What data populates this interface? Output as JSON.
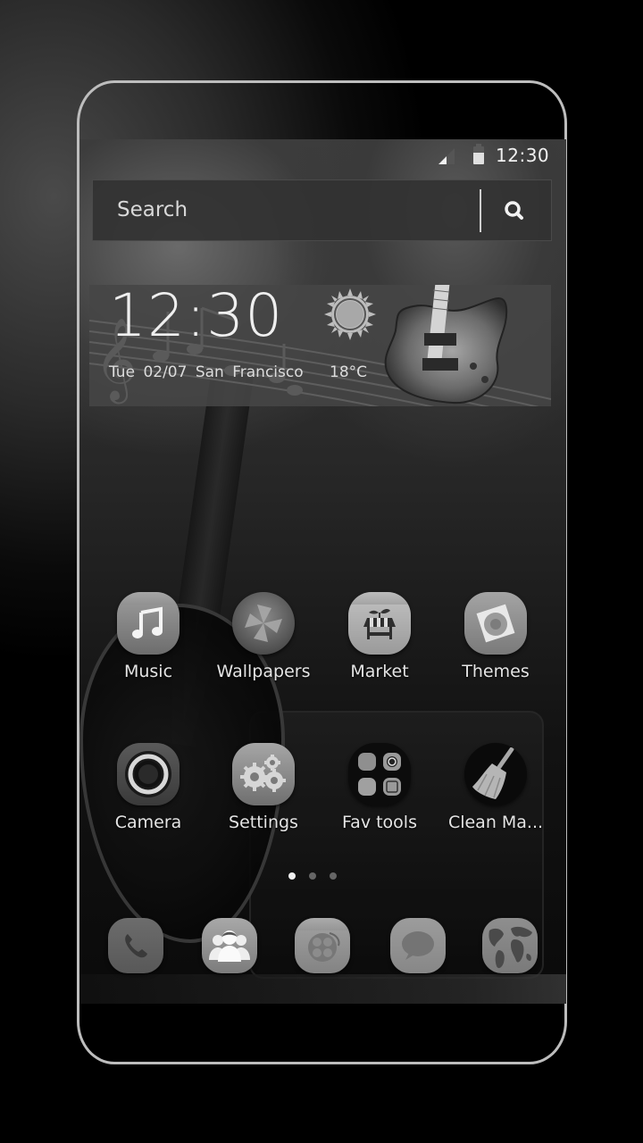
{
  "status_bar": {
    "time": "12:30",
    "icons": [
      "signal-icon",
      "battery-icon"
    ]
  },
  "search": {
    "placeholder": "Search",
    "button_icon": "search-icon"
  },
  "widget": {
    "time": "12:30",
    "day": "Tue",
    "date": "02/07",
    "city": "San Francisco",
    "date_line": "Tue  02/07  San Francisco",
    "temperature": "18°C",
    "weather_icon": "sun-icon"
  },
  "apps": [
    {
      "label": "Music",
      "icon": "music-note-icon"
    },
    {
      "label": "Wallpapers",
      "icon": "pinwheel-icon"
    },
    {
      "label": "Market",
      "icon": "market-stall-icon"
    },
    {
      "label": "Themes",
      "icon": "flower-picture-icon"
    },
    {
      "label": "Camera",
      "icon": "camera-lens-icon"
    },
    {
      "label": "Settings",
      "icon": "gears-icon"
    },
    {
      "label": "Fav tools",
      "icon": "folder-grid-icon"
    },
    {
      "label": "Clean Ma...",
      "icon": "broom-icon"
    }
  ],
  "page_indicator": {
    "pages": 3,
    "current": 1
  },
  "dock": [
    {
      "name": "Phone",
      "icon": "phone-icon"
    },
    {
      "name": "Contacts",
      "icon": "contacts-icon"
    },
    {
      "name": "Apps",
      "icon": "app-drawer-icon"
    },
    {
      "name": "Messages",
      "icon": "chat-bubble-icon"
    },
    {
      "name": "Browser",
      "icon": "globe-icon"
    }
  ]
}
